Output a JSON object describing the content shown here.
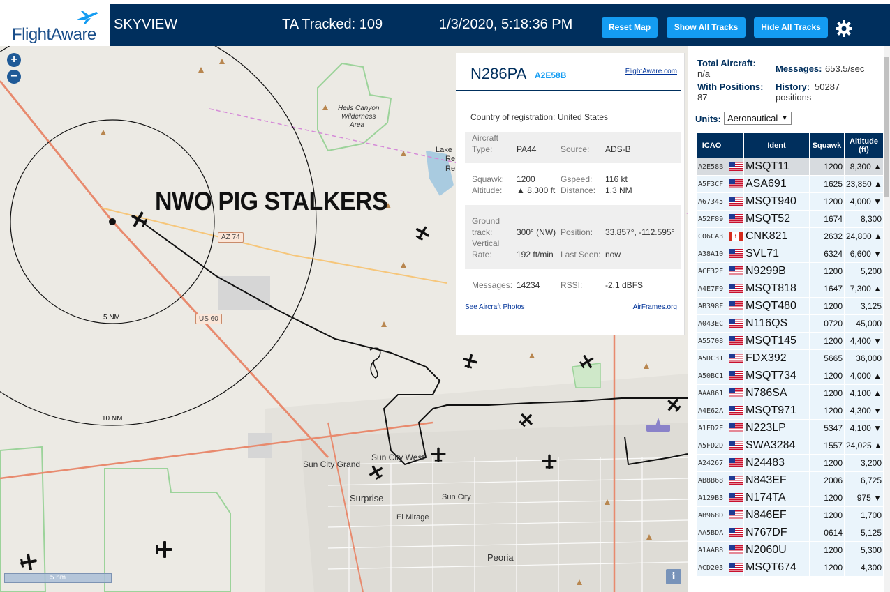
{
  "header": {
    "logo_text": "FlightAware",
    "title": "SKYVIEW",
    "tracked": "TA Tracked: 109",
    "clock": "1/3/2020, 5:18:36 PM",
    "buttons": {
      "reset": "Reset Map",
      "show_all": "Show All Tracks",
      "hide_all": "Hide All Tracks"
    }
  },
  "map": {
    "zoom_in": "+",
    "zoom_out": "−",
    "overlay_text": "NWO PIG STALKERS",
    "labels": {
      "hells_canyon": "Hells Canyon",
      "wilderness": "Wilderness",
      "area": "Area",
      "lake": "Lake",
      "reg": "Re",
      "rec": "Re",
      "sun_city_grand": "Sun City Grand",
      "sun_city_west": "Sun City West",
      "surprise": "Surprise",
      "sun_city": "Sun City",
      "el_mirage": "El Mirage",
      "peoria": "Peoria"
    },
    "rings": {
      "inner": "5 NM",
      "outer": "10 NM"
    },
    "highways": {
      "az74": "AZ 74",
      "us60": "US 60"
    },
    "scale": "5 nm",
    "info": "i"
  },
  "detail": {
    "ident": "N286PA",
    "icao": "A2E58B",
    "fa_link": "FlightAware.com",
    "country_label": "Country of registration:",
    "country": "United States",
    "aircraft_type_label1": "Aircraft",
    "aircraft_type_label2": "Type:",
    "aircraft_type": "PA44",
    "source_label": "Source:",
    "source": "ADS-B",
    "squawk_label": "Squawk:",
    "squawk": "1200",
    "gspeed_label": "Gspeed:",
    "gspeed": "116 kt",
    "altitude_label": "Altitude:",
    "altitude": "▲ 8,300 ft",
    "distance_label": "Distance:",
    "distance": "1.3 NM",
    "ground_track_label1": "Ground",
    "ground_track_label2": "track:",
    "ground_track": "300° (NW)",
    "position_label": "Position:",
    "position": "33.857°, -112.595°",
    "vrate_label1": "Vertical",
    "vrate_label2": "Rate:",
    "vrate": "192 ft/min",
    "last_seen_label": "Last Seen:",
    "last_seen": "now",
    "messages_label": "Messages:",
    "messages": "14234",
    "rssi_label": "RSSI:",
    "rssi": "-2.1 dBFS",
    "photos_link": "See Aircraft Photos",
    "airframes_link": "AirFrames.org"
  },
  "panel": {
    "total_label": "Total Aircraft:",
    "total": "n/a",
    "messages_label": "Messages:",
    "messages": "653.5/sec",
    "positions_label": "With Positions:",
    "positions": "87",
    "history_label": "History:",
    "history": "50287",
    "history_unit": "positions",
    "units_label": "Units:",
    "units_value": "Aeronautical",
    "columns": {
      "icao": "ICAO",
      "flag": "",
      "ident": "Ident",
      "squawk": "Squawk",
      "altitude1": "Altitude",
      "altitude2": "(ft)"
    },
    "rows": [
      {
        "icao": "A2E58B",
        "flag": "us",
        "ident": "MSQT11",
        "squawk": "1200",
        "alt": "8,300 ▲"
      },
      {
        "icao": "A5F3CF",
        "flag": "us",
        "ident": "ASA691",
        "squawk": "1625",
        "alt": "23,850 ▲"
      },
      {
        "icao": "A67345",
        "flag": "us",
        "ident": "MSQT940",
        "squawk": "1200",
        "alt": "4,000 ▼"
      },
      {
        "icao": "A52F89",
        "flag": "us",
        "ident": "MSQT52",
        "squawk": "1674",
        "alt": "8,300"
      },
      {
        "icao": "C06CA3",
        "flag": "ca",
        "ident": "CNK821",
        "squawk": "2632",
        "alt": "24,800 ▲"
      },
      {
        "icao": "A38A10",
        "flag": "us",
        "ident": "SVL71",
        "squawk": "6324",
        "alt": "6,600 ▼"
      },
      {
        "icao": "ACE32E",
        "flag": "us",
        "ident": "N9299B",
        "squawk": "1200",
        "alt": "5,200"
      },
      {
        "icao": "A4E7F9",
        "flag": "us",
        "ident": "MSQT818",
        "squawk": "1647",
        "alt": "7,300 ▲"
      },
      {
        "icao": "AB398F",
        "flag": "us",
        "ident": "MSQT480",
        "squawk": "1200",
        "alt": "3,125"
      },
      {
        "icao": "A043EC",
        "flag": "us",
        "ident": "N116QS",
        "squawk": "0720",
        "alt": "45,000"
      },
      {
        "icao": "A55708",
        "flag": "us",
        "ident": "MSQT145",
        "squawk": "1200",
        "alt": "4,400 ▼"
      },
      {
        "icao": "A5DC31",
        "flag": "us",
        "ident": "FDX392",
        "squawk": "5665",
        "alt": "36,000"
      },
      {
        "icao": "A50BC1",
        "flag": "us",
        "ident": "MSQT734",
        "squawk": "1200",
        "alt": "4,000 ▲"
      },
      {
        "icao": "AAA861",
        "flag": "us",
        "ident": "N786SA",
        "squawk": "1200",
        "alt": "4,100 ▲"
      },
      {
        "icao": "A4E62A",
        "flag": "us",
        "ident": "MSQT971",
        "squawk": "1200",
        "alt": "4,300 ▼"
      },
      {
        "icao": "A1ED2E",
        "flag": "us",
        "ident": "N223LP",
        "squawk": "5347",
        "alt": "4,100 ▼"
      },
      {
        "icao": "A5FD2D",
        "flag": "us",
        "ident": "SWA3284",
        "squawk": "1557",
        "alt": "24,025 ▲"
      },
      {
        "icao": "A24267",
        "flag": "us",
        "ident": "N24483",
        "squawk": "1200",
        "alt": "3,200"
      },
      {
        "icao": "AB8B68",
        "flag": "us",
        "ident": "N843EF",
        "squawk": "2006",
        "alt": "6,725"
      },
      {
        "icao": "A129B3",
        "flag": "us",
        "ident": "N174TA",
        "squawk": "1200",
        "alt": "975 ▼"
      },
      {
        "icao": "AB968D",
        "flag": "us",
        "ident": "N846EF",
        "squawk": "1200",
        "alt": "1,700"
      },
      {
        "icao": "AA5BDA",
        "flag": "us",
        "ident": "N767DF",
        "squawk": "0614",
        "alt": "5,125"
      },
      {
        "icao": "A1AAB8",
        "flag": "us",
        "ident": "N2060U",
        "squawk": "1200",
        "alt": "5,300"
      },
      {
        "icao": "ACD203",
        "flag": "us",
        "ident": "MSQT674",
        "squawk": "1200",
        "alt": "4,300"
      }
    ]
  },
  "colors": {
    "header_bg": "#002f5d",
    "button_bg": "#149cf2",
    "row_bg": "#eaf4fb",
    "selected_row_bg": "#d7dbdf"
  },
  "icons": [
    "plane-icon",
    "gear-icon",
    "flag-us-icon",
    "flag-ca-icon",
    "info-icon"
  ]
}
